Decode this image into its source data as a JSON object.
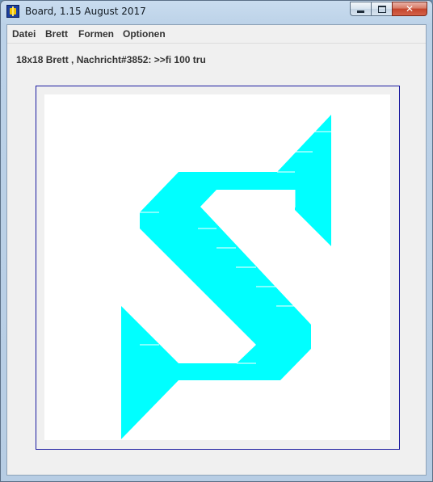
{
  "window": {
    "title": "Board, 1.15 August 2017",
    "app_icon": "board-app-icon",
    "buttons": {
      "minimize_icon": "minimize-icon",
      "maximize_icon": "maximize-icon",
      "close_glyph": "✕"
    }
  },
  "menu": {
    "items": [
      {
        "label": "Datei"
      },
      {
        "label": "Brett"
      },
      {
        "label": "Formen"
      },
      {
        "label": "Optionen"
      }
    ]
  },
  "status": {
    "text": "18x18 Brett , Nachricht#3852: >>fi 100 tru"
  },
  "board": {
    "grid": "18x18",
    "background_color": "#ffffff",
    "frame_color": "#1a1aa0",
    "shape_color": "#00ffff",
    "shape_icon": "s-shape-with-arrowheads"
  }
}
